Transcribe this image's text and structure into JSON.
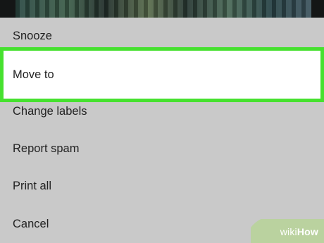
{
  "menu": {
    "items": [
      {
        "label": "Snooze"
      },
      {
        "label": "Move to"
      },
      {
        "label": "Change labels"
      },
      {
        "label": "Report spam"
      },
      {
        "label": "Print all"
      },
      {
        "label": "Cancel"
      }
    ],
    "highlighted_index": 1
  },
  "watermark": {
    "prefix": "wiki",
    "suffix": "How"
  },
  "colors": {
    "background": "#c9c9c9",
    "highlight_bg": "#ffffff",
    "highlight_border": "#46e12f",
    "text": "#222222"
  }
}
